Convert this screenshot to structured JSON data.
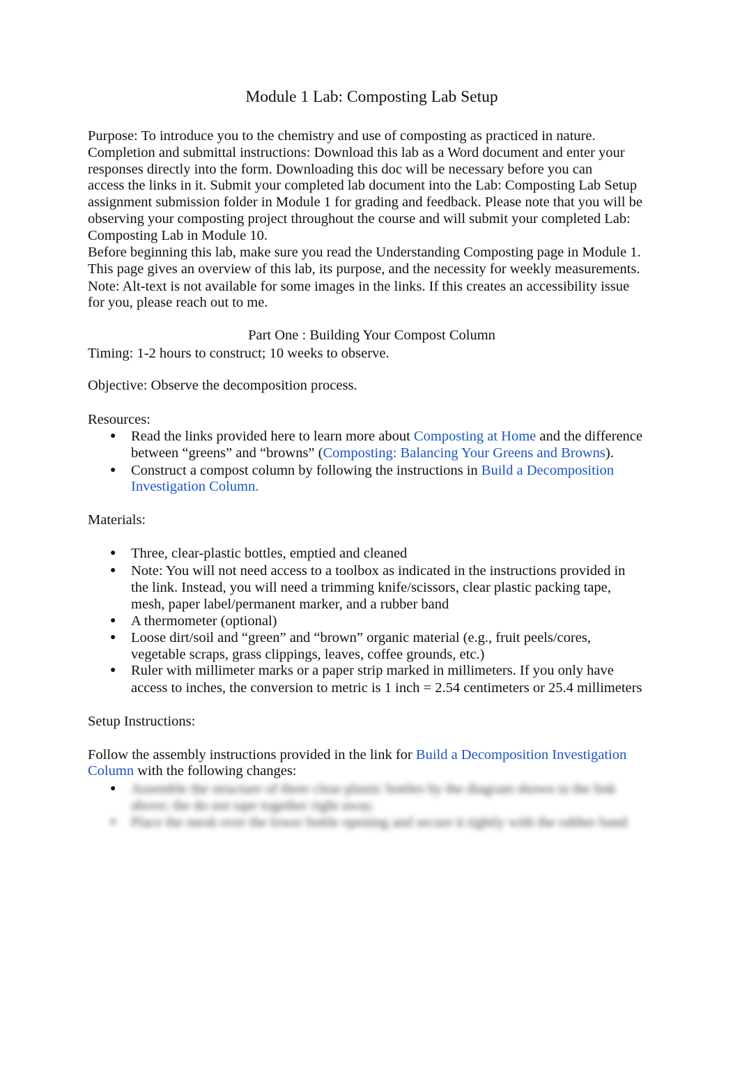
{
  "title": "Module 1 Lab: Composting Lab Setup",
  "intro": {
    "purpose_line": "Purpose:   To introduce you to the chemistry and use of composting as practiced in nature.",
    "lines": [
      "Completion and submittal instructions:      Download this lab as a Word document and enter your",
      "responses directly into the form. Downloading this doc will be necessary before you can",
      "access the links in it.   Submit your completed lab document into the Lab: Composting Lab Setup",
      "assignment submission folder in Module 1 for grading and feedback. Please note that you will be",
      "observing your composting project throughout the course and will submit your completed Lab:",
      "Composting Lab in Module 10.",
      "Before beginning this lab, make sure you read the Understanding Composting page in Module 1.",
      "This page gives an overview of this lab, its purpose, and the necessity for weekly measurements.",
      "Note: Alt-text is not available for some images in the links. If this creates an accessibility issue",
      "for you, please reach out to me."
    ]
  },
  "part_one": {
    "heading": "Part One : Building Your Compost Column",
    "timing": "Timing:   1-2 hours to construct; 10 weeks to observe.",
    "objective": "Objective:   Observe the decomposition process.",
    "resources_label": "Resources:",
    "resources": {
      "item1_pre": "Read the links provided here to learn more about ",
      "item1_link1": "Composting at Home",
      "item1_mid": " and the difference",
      "item1_line2_pre": "between “greens” and “browns” (",
      "item1_link2": "Composting: Balancing Your Greens and Browns",
      "item1_line2_post": ").",
      "item2_pre": "Construct a compost column by following the instructions in ",
      "item2_link_a": "Build a Decomposition",
      "item2_link_b": "Investigation Column."
    },
    "materials_label": "Materials:",
    "materials": [
      [
        "Three, clear-plastic bottles, emptied and cleaned"
      ],
      [
        "Note: You will not need access to a toolbox as indicated in the instructions provided in",
        "the link. Instead, you will need a trimming knife/scissors, clear plastic packing tape,",
        "mesh, paper label/permanent marker, and a rubber band"
      ],
      [
        "A thermometer (optional)"
      ],
      [
        "Loose dirt/soil and “green” and “brown” organic material (e.g., fruit peels/cores,",
        "vegetable scraps, grass clippings, leaves, coffee grounds, etc.)"
      ],
      [
        "Ruler with millimeter marks or a paper strip marked in millimeters.  If you only have",
        "access to inches, the conversion to metric is 1 inch = 2.54 centimeters or 25.4 millimeters"
      ]
    ],
    "setup_label": "Setup Instructions:",
    "setup": {
      "pre": "Follow the assembly instructions provided in the link for ",
      "link_a": "Build a Decomposition Investigation",
      "link_b": "Column",
      "post": " with the following changes:"
    },
    "blurred_lines": [
      "Assemble the structure of three clear-plastic bottles by the diagram shown in the link",
      "above; the do not tape together right away.",
      "Place the mesh over the lower bottle opening and secure it tightly with the rubber band"
    ]
  },
  "bullet_char": "●"
}
